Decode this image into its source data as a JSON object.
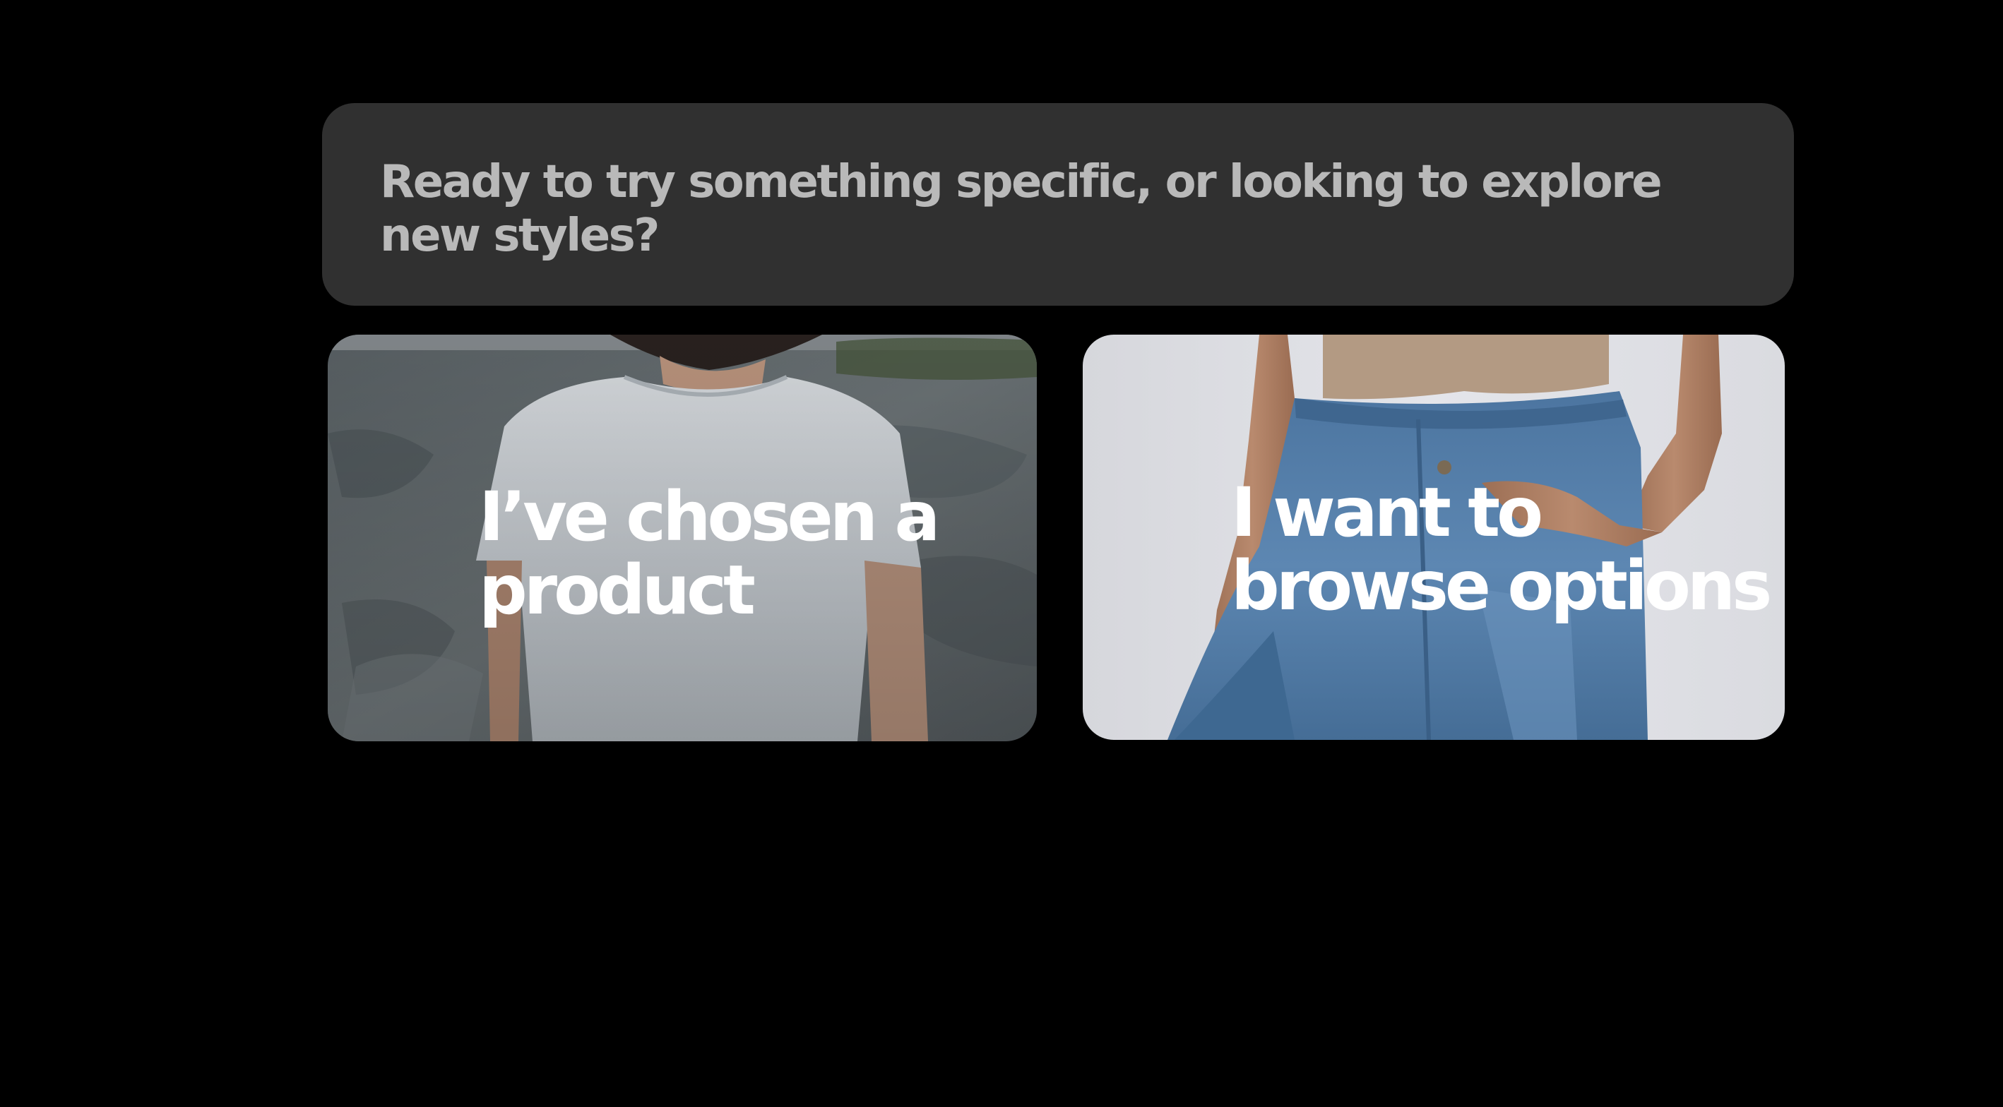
{
  "prompt": {
    "question": "Ready to try something specific, or looking to explore new styles?"
  },
  "options": [
    {
      "label_line1": "I’ve chosen a",
      "label_line2": "product",
      "image_icon": "photo-white-tshirt"
    },
    {
      "label_line1": "I want to",
      "label_line2": "browse options",
      "image_icon": "photo-blue-jeans"
    }
  ],
  "colors": {
    "background": "#000000",
    "prompt_box": "#303030",
    "prompt_text": "#b9b9b9",
    "card_text": "#ffffff"
  }
}
